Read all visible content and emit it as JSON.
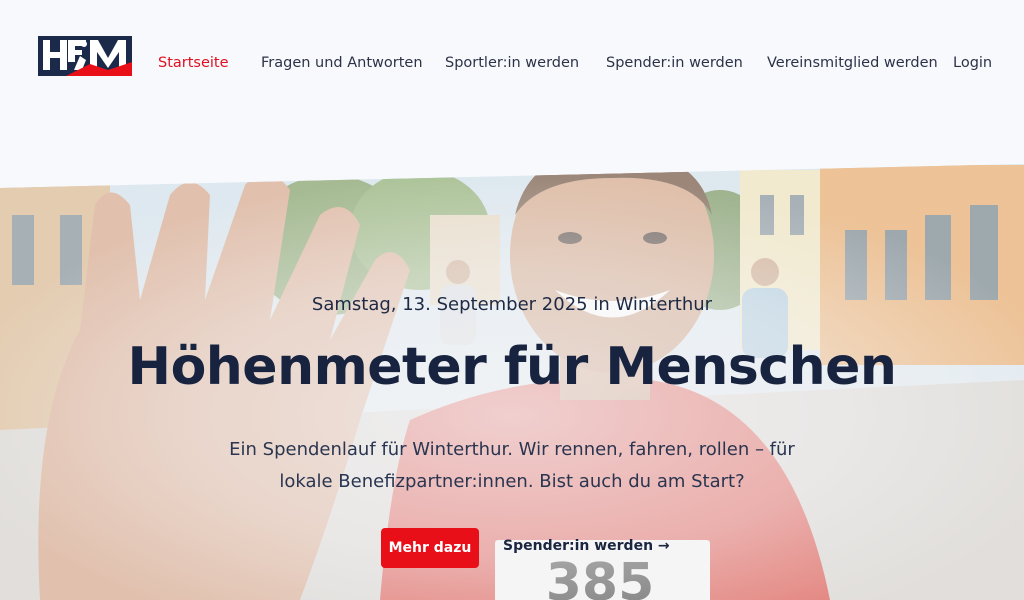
{
  "header": {
    "logo_text": "HFM",
    "nav": [
      {
        "label": "Startseite",
        "active": true
      },
      {
        "label": "Fragen und Antworten",
        "active": false
      },
      {
        "label": "Sportler:in werden",
        "active": false
      },
      {
        "label": "Spender:in werden",
        "active": false
      },
      {
        "label": "Vereinsmitglied werden",
        "active": false
      },
      {
        "label": "Login",
        "active": false
      }
    ]
  },
  "hero": {
    "date": "Samstag, 13. September 2025 in Winterthur",
    "title": "Höhenmeter für Menschen",
    "lead": "Ein Spendenlauf für Winterthur. Wir rennen, fahren, rollen – für lokale Benefizpartner:innen. Bist auch du am Start?",
    "primary_button": "Mehr dazu",
    "secondary_link": "Spender:in werden →",
    "bib_number": "385"
  },
  "colors": {
    "accent": "#e80f19",
    "navy": "#1b2a4a",
    "background": "#f8f9fc"
  }
}
